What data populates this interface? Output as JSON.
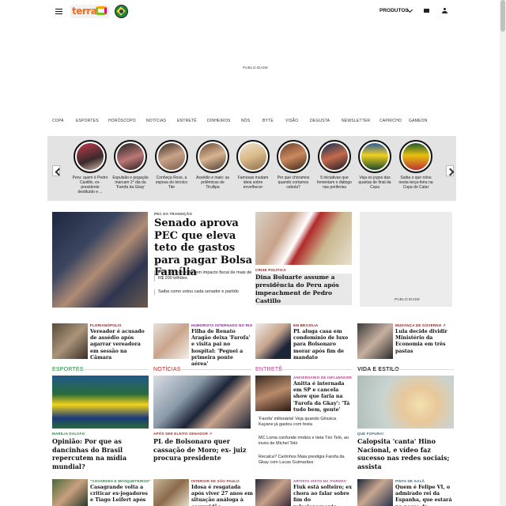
{
  "header": {
    "logo_text": "terra",
    "produtos_label": "PRODUTOS"
  },
  "ads": {
    "top_label": "PUBLICIDADE",
    "side_label": "PUBLICIDADE"
  },
  "nav": [
    "COPA",
    "ESPORTES",
    "HORÓSCOPO",
    "NOTÍCIAS",
    "ENTRETÊ",
    "DINHEIROS",
    "NÓS",
    "BYTE",
    "VISÃO",
    "DEGUSTA",
    "NEWSLETTER",
    "CAPRICHO",
    "GAMEON"
  ],
  "stories": [
    {
      "caption": "Peru: quem é Pedro Castillo, ex-presidente destituído e ..."
    },
    {
      "caption": "Expulsão e pegação marcam 2° dia da 'Farofa da Gkay'"
    },
    {
      "caption": "Conheça Rose, a esposa do técnico Tite"
    },
    {
      "caption": "Assédio e mais: as polêmicas de Tirullipa"
    },
    {
      "caption": "Famosas mudam ideia sobre envelhecer"
    },
    {
      "caption": "Por que choramos quando cortamos cebola?"
    },
    {
      "caption": "5 iniciativas que fomentam o diálogo nas periferias"
    },
    {
      "caption": "Veja os jogos das quartas de final da Copa"
    },
    {
      "caption": "Saiba o que rolou nesta terça-feira na Copa do Catar"
    }
  ],
  "lead": {
    "tag": "PEC DA TRANSIÇÃO",
    "headline": "Senado aprova PEC que eleva teto de gastos para pagar Bolsa Família",
    "bullets": [
      "PEC da Transição tem impacto fiscal de mais de R$ 200 bilhões",
      "Saiba como votou cada senador e partido"
    ]
  },
  "second": {
    "tag": "CRISE POLÍTICA",
    "headline": "Dina Boluarte assume a presidência do Peru após impeachment de Pedro Castillo"
  },
  "row1": [
    {
      "tag": "FLORIANÓPOLIS",
      "headline": "Vereador é acusado de assédio após agarrar vereadora em sessão na Câmara"
    },
    {
      "tag": "HUMORISTA INTERNADO NO RIO",
      "headline": "Filha de Renato Aragão deixa 'Farofa' e visita pai no hospital: 'Peguei a primeira ponte aérea'"
    },
    {
      "tag": "EM BRASÍLIA",
      "headline": "PL aluga casa em condomínio de luxo para Bolsonaro morar após fim de mandato"
    },
    {
      "tag": "MUDANÇA DE GOVERNO ↗",
      "headline": "Lula decide dividir Ministério da Economia em três pastas"
    }
  ],
  "sections": {
    "esportes": "ESPORTES",
    "noticias": "NOTÍCIAS",
    "entrete": "ENTRETÊ",
    "vida": "VIDA E ESTILO"
  },
  "esportes_card": {
    "tag": "MARÍLIA DALVÃO",
    "headline": "Opinião: Por que as dancinhas do Brasil repercutem na mídia mundial?"
  },
  "noticias_card": {
    "tag": "APÓS SER ELEITO SENADOR ↗",
    "headline": "PL de Bolsonaro quer cassação de Moro; ex- juiz procura presidente"
  },
  "entrete_top": {
    "tag": "ANIVERSÁRIO DE INFLUENCER",
    "headline": "Anitta é internada em SP e cancela show que faria na 'Farofa da Gkay': 'Tá tudo bem, gente'"
  },
  "entrete_list": [
    "'Farofa' milionária! Veja quando Gêssica Kayane já gastou com festa",
    "MC Loma confunde irmãos e tieta Téo Teló, ao invés de Michel Teló",
    "Recalca? Carlinhos Maia prestigia Farofa da Gkay com Lucas Guimarães"
  ],
  "vida_card": {
    "tag": "QUE FOFURA!",
    "headline": "Calopsita 'canta' Hino Nacional, e vídeo faz sucesso nas redes sociais; assista"
  },
  "row3": [
    {
      "tag": "\"COVARDES E MOSQUETEIROS\"",
      "headline": "Casagrande volta a criticar ex-jogadores e Tiago Leifert após"
    },
    {
      "tag": "INTERIOR DE SÃO PAULO",
      "headline": "Idosa é resgatada após viver 27 anos em situação análoga à escravidão"
    },
    {
      "tag": "ARTISTA VISTO NA 'FAROFA'",
      "headline": "Fiuk está solteiro; ex chora ao falar sobre fim do relacionamento"
    },
    {
      "tag": "PINTA DE GALÃ",
      "headline": "Quem é Felipe VI, o admirado rei da Espanha, que estará na posse de"
    }
  ]
}
